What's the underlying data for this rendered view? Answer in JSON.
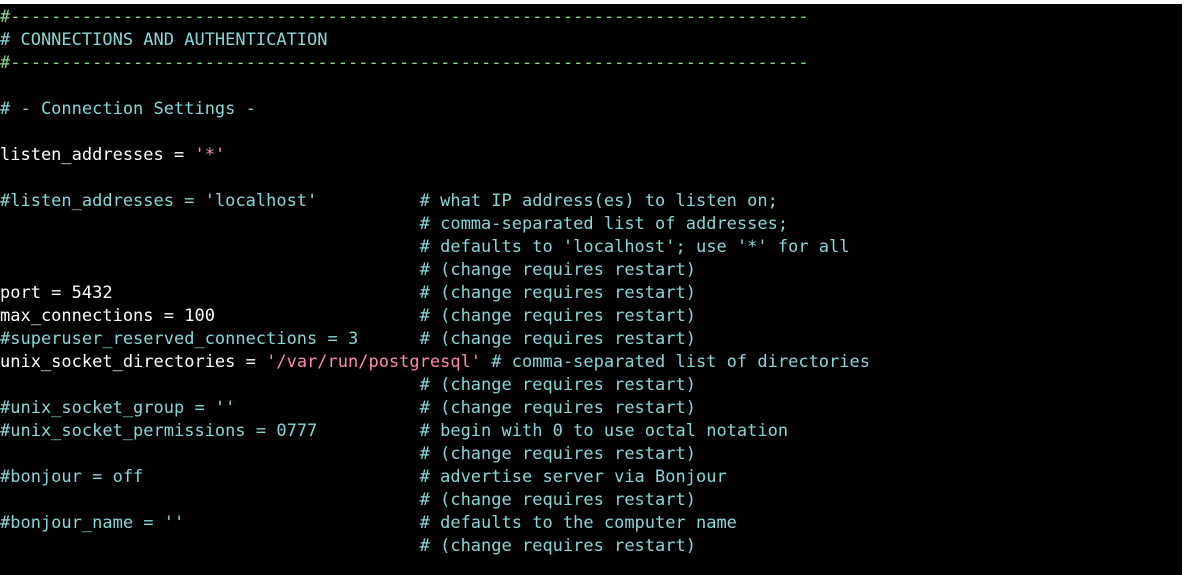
{
  "colors": {
    "background": "#000000",
    "code_text": "#ffffff",
    "comment": "#87d7d7",
    "rule_comment": "#87d787",
    "string": "#ff87af"
  },
  "lines": [
    "#------------------------------------------------------------------------------",
    "# CONNECTIONS AND AUTHENTICATION",
    "#------------------------------------------------------------------------------",
    "",
    "# - Connection Settings -",
    "",
    "listen_addresses = '*'",
    "",
    "#listen_addresses = 'localhost'          # what IP address(es) to listen on;",
    "                                         # comma-separated list of addresses;",
    "                                         # defaults to 'localhost'; use '*' for all",
    "                                         # (change requires restart)",
    "port = 5432                              # (change requires restart)",
    "max_connections = 100                    # (change requires restart)",
    "#superuser_reserved_connections = 3      # (change requires restart)",
    "unix_socket_directories = '/var/run/postgresql' # comma-separated list of directories",
    "                                         # (change requires restart)",
    "#unix_socket_group = ''                  # (change requires restart)",
    "#unix_socket_permissions = 0777          # begin with 0 to use octal notation",
    "                                         # (change requires restart)",
    "#bonjour = off                           # advertise server via Bonjour",
    "                                         # (change requires restart)",
    "#bonjour_name = ''                       # defaults to the computer name",
    "                                         # (change requires restart)"
  ]
}
